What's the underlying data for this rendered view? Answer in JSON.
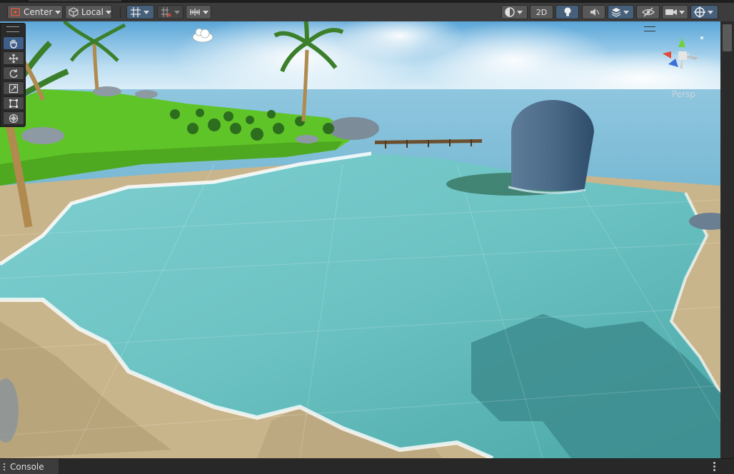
{
  "toolbar": {
    "pivot_label": "Center",
    "space_label": "Local",
    "mode_2d_label": "2D"
  },
  "scene": {
    "camera_label": "Persp"
  },
  "tools": [
    "hand-tool",
    "move-tool",
    "rotate-tool",
    "scale-tool",
    "rect-tool",
    "transform-tool"
  ],
  "bottom": {
    "console_label": "Console"
  },
  "colors": {
    "accent": "#46607c",
    "toolbar_bg": "#3c3c3c",
    "water": "#6ec6c6",
    "sand": "#c9b58c",
    "grass": "#5fc428"
  }
}
